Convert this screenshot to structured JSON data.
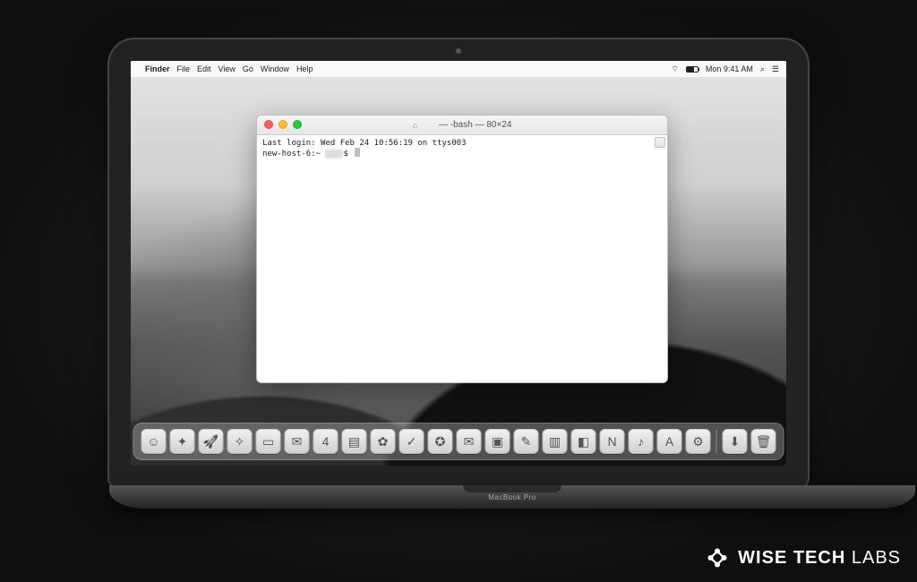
{
  "menubar": {
    "apple_glyph": "",
    "app_name": "Finder",
    "items": [
      "File",
      "Edit",
      "View",
      "Go",
      "Window",
      "Help"
    ],
    "status_time": "Mon 9:41 AM",
    "wifi_glyph": "⌔",
    "search_glyph": "⌕",
    "menu_glyph": "☰"
  },
  "terminal": {
    "title_home_glyph": "⌂",
    "title_user_masked": "     ",
    "title_suffix": " — -bash — 80×24",
    "line1": "Last login: Wed Feb 24 10:56:19 on ttys003",
    "prompt_host": "new-host-6:~ ",
    "prompt_user_masked": "     ",
    "prompt_dollar": "$ "
  },
  "dock": {
    "items": [
      {
        "name": "finder-icon",
        "glyph": "☺"
      },
      {
        "name": "safari-icon",
        "glyph": "✦"
      },
      {
        "name": "launchpad-icon",
        "glyph": "🚀"
      },
      {
        "name": "compass-icon",
        "glyph": "✧"
      },
      {
        "name": "contacts-icon",
        "glyph": "▭"
      },
      {
        "name": "mail-icon",
        "glyph": "✉"
      },
      {
        "name": "calendar-icon",
        "glyph": "4"
      },
      {
        "name": "notes-icon",
        "glyph": "▤"
      },
      {
        "name": "photos-icon",
        "glyph": "✿"
      },
      {
        "name": "reminders-icon",
        "glyph": "✓"
      },
      {
        "name": "clock-icon",
        "glyph": "✪"
      },
      {
        "name": "messages-icon",
        "glyph": "✉"
      },
      {
        "name": "facetime-icon",
        "glyph": "▣"
      },
      {
        "name": "pages-icon",
        "glyph": "✎"
      },
      {
        "name": "numbers-icon",
        "glyph": "▥"
      },
      {
        "name": "keynote-icon",
        "glyph": "◧"
      },
      {
        "name": "news-icon",
        "glyph": "N"
      },
      {
        "name": "itunes-icon",
        "glyph": "♪"
      },
      {
        "name": "appstore-icon",
        "glyph": "A"
      },
      {
        "name": "preferences-icon",
        "glyph": "⚙"
      }
    ],
    "right_items": [
      {
        "name": "downloads-icon",
        "glyph": "⬇"
      },
      {
        "name": "trash-icon",
        "glyph": "🗑"
      }
    ]
  },
  "laptop": {
    "label": "MacBook Pro"
  },
  "watermark": {
    "brand_bold": "WISE TECH",
    "brand_light": " LABS"
  }
}
